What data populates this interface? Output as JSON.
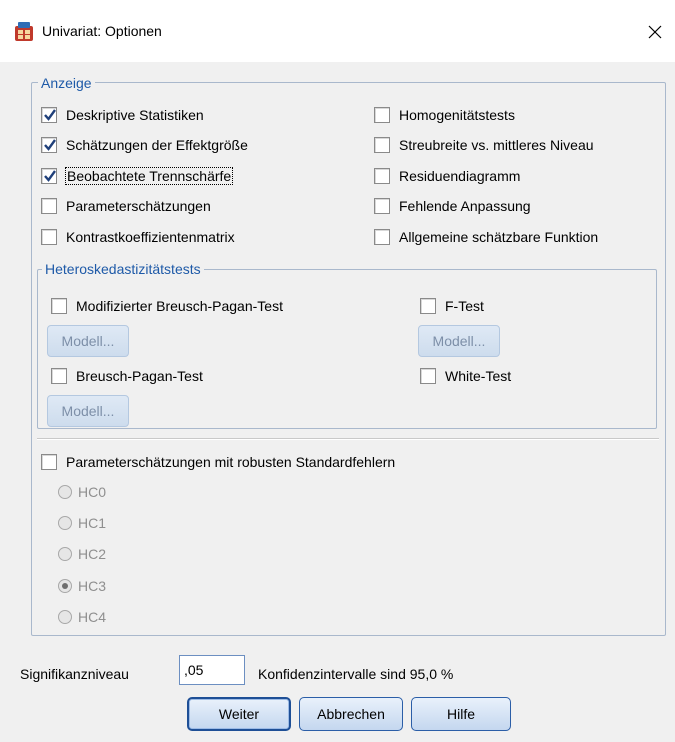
{
  "window": {
    "title": "Univariat: Optionen",
    "close_label": "✕"
  },
  "display_group": {
    "legend": "Anzeige",
    "left_options": [
      {
        "label": "Deskriptive Statistiken",
        "checked": true
      },
      {
        "label": "Schätzungen der Effektgröße",
        "checked": true
      },
      {
        "label": "Beobachtete Trennschärfe",
        "checked": true
      },
      {
        "label": "Parameterschätzungen",
        "checked": false
      },
      {
        "label": "Kontrastkoeffizientenmatrix",
        "checked": false
      }
    ],
    "right_options": [
      {
        "label": "Homogenitätstests",
        "checked": false
      },
      {
        "label": "Streubreite vs. mittleres Niveau",
        "checked": false
      },
      {
        "label": "Residuendiagramm",
        "checked": false
      },
      {
        "label": "Fehlende Anpassung",
        "checked": false
      },
      {
        "label": "Allgemeine schätzbare Funktion",
        "checked": false
      }
    ]
  },
  "hetero_group": {
    "legend": "Heteroskedastizitätstests",
    "tests": [
      {
        "label": "Modifizierter Breusch-Pagan-Test",
        "checked": false,
        "button": "Modell..."
      },
      {
        "label": "F-Test",
        "checked": false,
        "button": "Modell..."
      },
      {
        "label": "Breusch-Pagan-Test",
        "checked": false,
        "button": "Modell..."
      },
      {
        "label": "White-Test",
        "checked": false
      }
    ]
  },
  "robust": {
    "label": "Parameterschätzungen mit robusten Standardfehlern",
    "checked": false,
    "options": [
      {
        "label": "HC0",
        "selected": false
      },
      {
        "label": "HC1",
        "selected": false
      },
      {
        "label": "HC2",
        "selected": false
      },
      {
        "label": "HC3",
        "selected": true
      },
      {
        "label": "HC4",
        "selected": false
      }
    ]
  },
  "significance": {
    "label": "Signifikanzniveau",
    "value": ",05",
    "confidence_text": "Konfidenzintervalle sind 95,0 %"
  },
  "buttons": {
    "continue": "Weiter",
    "cancel": "Abbrechen",
    "help": "Hilfe"
  },
  "colors": {
    "legend": "#1e5aa8",
    "check": "#1f3f7a",
    "group_border": "#a9b8cc"
  }
}
